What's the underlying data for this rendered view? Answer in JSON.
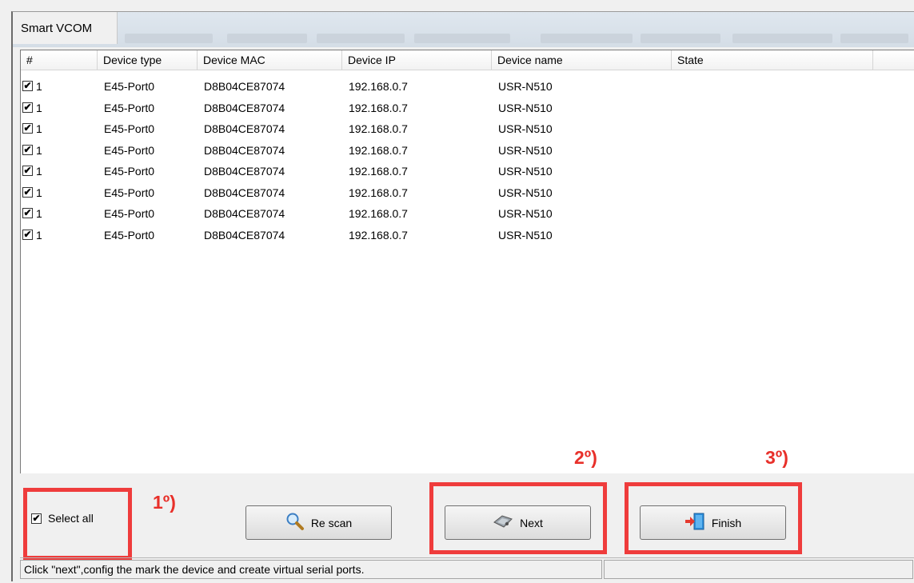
{
  "window": {
    "title": "Smart VCOM"
  },
  "columns": [
    "#",
    "Device type",
    "Device MAC",
    "Device IP",
    "Device name",
    "State"
  ],
  "rows": [
    {
      "checked": true,
      "num": "1",
      "type": "E45-Port0",
      "mac": "D8B04CE87074",
      "ip": "192.168.0.7",
      "name": "USR-N510",
      "state": ""
    },
    {
      "checked": true,
      "num": "1",
      "type": "E45-Port0",
      "mac": "D8B04CE87074",
      "ip": "192.168.0.7",
      "name": "USR-N510",
      "state": ""
    },
    {
      "checked": true,
      "num": "1",
      "type": "E45-Port0",
      "mac": "D8B04CE87074",
      "ip": "192.168.0.7",
      "name": "USR-N510",
      "state": ""
    },
    {
      "checked": true,
      "num": "1",
      "type": "E45-Port0",
      "mac": "D8B04CE87074",
      "ip": "192.168.0.7",
      "name": "USR-N510",
      "state": ""
    },
    {
      "checked": true,
      "num": "1",
      "type": "E45-Port0",
      "mac": "D8B04CE87074",
      "ip": "192.168.0.7",
      "name": "USR-N510",
      "state": ""
    },
    {
      "checked": true,
      "num": "1",
      "type": "E45-Port0",
      "mac": "D8B04CE87074",
      "ip": "192.168.0.7",
      "name": "USR-N510",
      "state": ""
    },
    {
      "checked": true,
      "num": "1",
      "type": "E45-Port0",
      "mac": "D8B04CE87074",
      "ip": "192.168.0.7",
      "name": "USR-N510",
      "state": ""
    },
    {
      "checked": true,
      "num": "1",
      "type": "E45-Port0",
      "mac": "D8B04CE87074",
      "ip": "192.168.0.7",
      "name": "USR-N510",
      "state": ""
    }
  ],
  "controls": {
    "select_all_label": "Select all",
    "select_all_checked": true,
    "rescan_label": "Re scan",
    "rescan_icon": "magnifier-icon",
    "next_label": "Next",
    "next_icon": "network-port-icon",
    "finish_label": "Finish",
    "finish_icon": "exit-door-icon"
  },
  "annotations": {
    "step1": "1º)",
    "step2": "2º)",
    "step3": "3º)",
    "highlight_color": "#ef3c3c"
  },
  "status": {
    "message": "Click \"next\",config the mark the device and create virtual serial ports."
  }
}
